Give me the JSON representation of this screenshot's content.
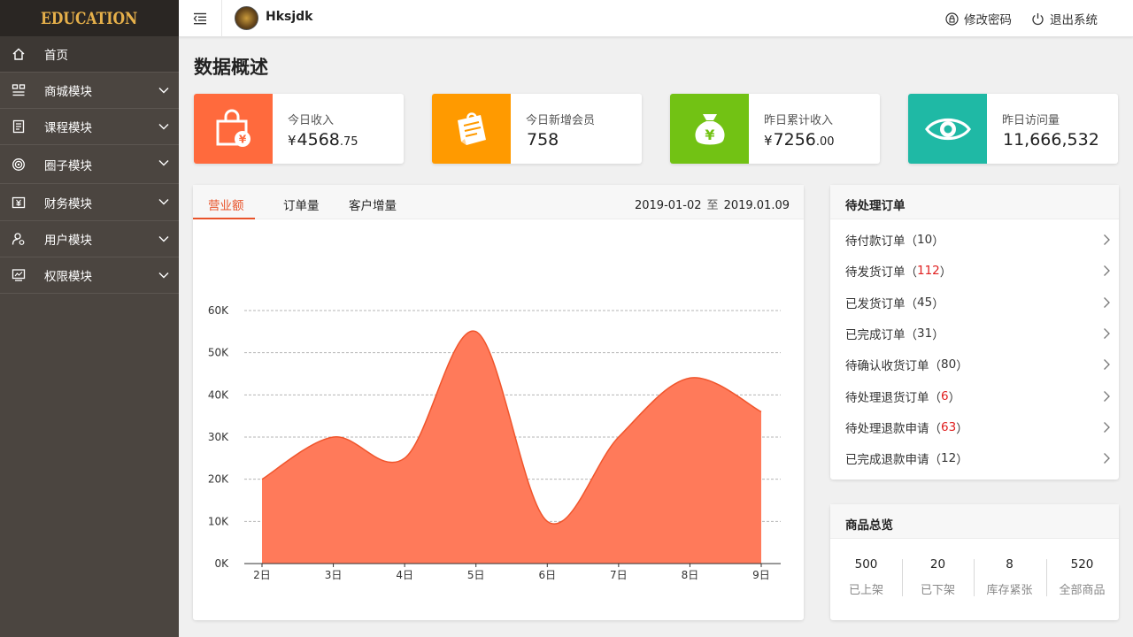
{
  "brand": {
    "logo": "EDUCATION"
  },
  "sidebar": {
    "items": [
      {
        "label": "首页",
        "icon": "home-icon"
      },
      {
        "label": "商城模块",
        "icon": "grid-icon"
      },
      {
        "label": "课程模块",
        "icon": "document-icon"
      },
      {
        "label": "圈子模块",
        "icon": "target-icon"
      },
      {
        "label": "财务模块",
        "icon": "money-icon"
      },
      {
        "label": "用户模块",
        "icon": "user-settings-icon"
      },
      {
        "label": "权限模块",
        "icon": "monitor-icon"
      }
    ]
  },
  "topbar": {
    "username": "Hksjdk",
    "change_password": "修改密码",
    "logout": "退出系统"
  },
  "page": {
    "title": "数据概述"
  },
  "stats": [
    {
      "label": "今日收入",
      "currency": "¥",
      "value_int": "4568",
      "value_dec": ".75",
      "color": "#ff6a3d",
      "icon": "shopping-bag-icon"
    },
    {
      "label": "今日新增会员",
      "currency": "",
      "value_int": "758",
      "value_dec": "",
      "color": "#ff9a00",
      "icon": "memo-icon"
    },
    {
      "label": "昨日累计收入",
      "currency": "¥",
      "value_int": "7256",
      "value_dec": ".00",
      "color": "#72c214",
      "icon": "money-bag-icon"
    },
    {
      "label": "昨日访问量",
      "currency": "",
      "value_int": "11,666,532",
      "value_dec": "",
      "color": "#1fb9a5",
      "icon": "eye-icon"
    }
  ],
  "chart_panel": {
    "tabs": [
      "营业额",
      "订单量",
      "客户增量"
    ],
    "date_from": "2019-01-02",
    "date_sep": "至",
    "date_to": "2019.01.09"
  },
  "chart_data": {
    "type": "area",
    "categories": [
      "2日",
      "3日",
      "4日",
      "5日",
      "6日",
      "7日",
      "8日",
      "9日"
    ],
    "series": [
      {
        "values": [
          20000,
          30000,
          25000,
          55000,
          10000,
          30000,
          44000,
          36000
        ]
      }
    ],
    "ylim": [
      0,
      60000
    ],
    "yticks": [
      "0K",
      "10K",
      "20K",
      "30K",
      "40K",
      "50K",
      "60K"
    ],
    "fill_color": "#ff7a5a",
    "line_color": "#f0552c",
    "grid": true
  },
  "pending": {
    "title": "待处理订单",
    "rows": [
      {
        "label": "待付款订单",
        "count": "10",
        "highlight": false
      },
      {
        "label": "待发货订单",
        "count": "112",
        "highlight": true
      },
      {
        "label": "已发货订单",
        "count": "45",
        "highlight": false
      },
      {
        "label": "已完成订单",
        "count": "31",
        "highlight": false
      },
      {
        "label": "待确认收货订单",
        "count": "80",
        "highlight": false
      },
      {
        "label": "待处理退货订单",
        "count": "6",
        "highlight": true
      },
      {
        "label": "待处理退款申请",
        "count": "63",
        "highlight": true
      },
      {
        "label": "已完成退款申请",
        "count": "12",
        "highlight": false
      }
    ]
  },
  "products": {
    "title": "商品总览",
    "items": [
      {
        "value": "500",
        "label": "已上架",
        "highlight": false
      },
      {
        "value": "20",
        "label": "已下架",
        "highlight": false
      },
      {
        "value": "8",
        "label": "库存紧张",
        "highlight": true
      },
      {
        "value": "520",
        "label": "全部商品",
        "highlight": false
      }
    ]
  }
}
